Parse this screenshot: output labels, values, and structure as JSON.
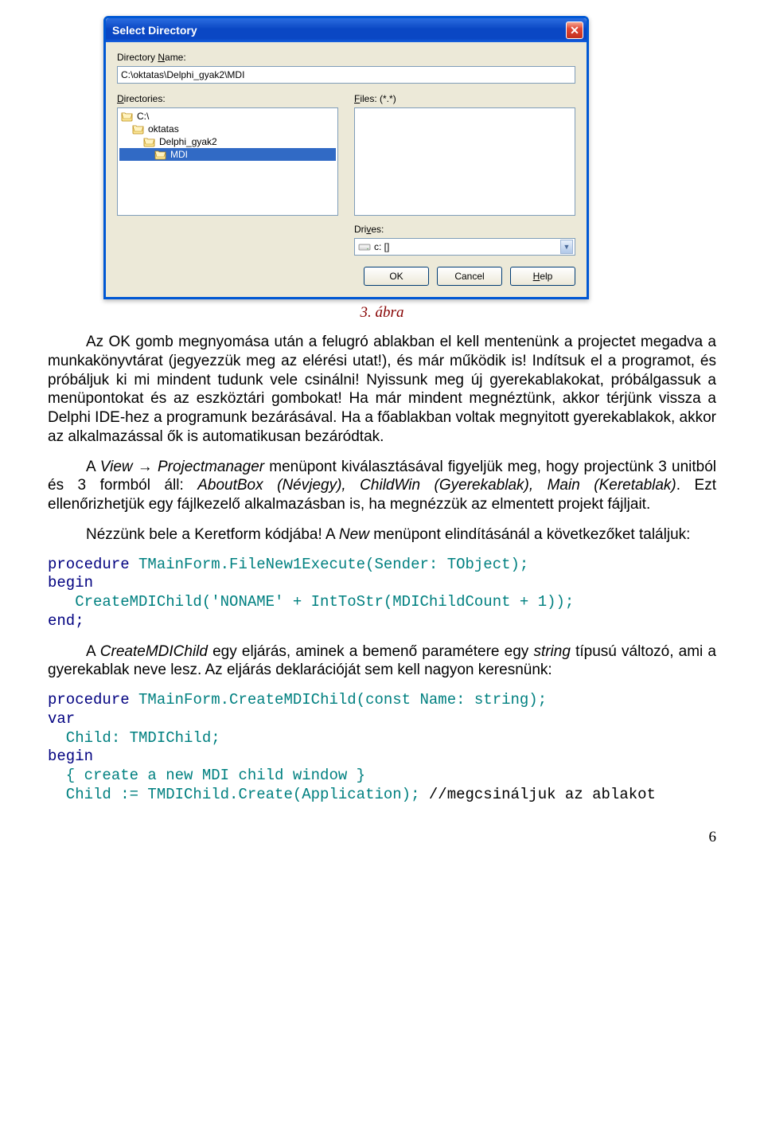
{
  "dialog": {
    "title": "Select Directory",
    "dirname_label": "Directory Name:",
    "dirname_underline": "N",
    "dirname_value": "C:\\oktatas\\Delphi_gyak2\\MDI",
    "directories_label": "Directories:",
    "directories_underline": "D",
    "dir_items": [
      {
        "label": "C:\\",
        "depth": 0,
        "selected": false
      },
      {
        "label": "oktatas",
        "depth": 1,
        "selected": false
      },
      {
        "label": "Delphi_gyak2",
        "depth": 2,
        "selected": false
      },
      {
        "label": "MDI",
        "depth": 3,
        "selected": true
      }
    ],
    "files_label": "Files: (*.*)",
    "files_underline": "F",
    "drives_label": "Drives:",
    "drives_underline": "v",
    "drives_value": "c: []",
    "buttons": {
      "ok": "OK",
      "cancel": "Cancel",
      "help": "Help",
      "help_underline": "H"
    }
  },
  "caption": "3. ábra",
  "paragraphs": {
    "p1": "Az OK gomb megnyomása után a felugró ablakban el kell mentenünk a projectet megadva a munkakönyvtárat (jegyezzük meg az elérési utat!), és már működik is! Indítsuk el a programot, és próbáljuk ki mi mindent tudunk vele csinálni! Nyissunk meg új gyerekablakokat, próbálgassuk a menüpontokat és az eszköztári gombokat! Ha már mindent megnéztünk, akkor térjünk vissza a Delphi IDE-hez a programunk bezárásával. Ha a főablakban voltak megnyitott gyerekablakok, akkor az alkalmazással ők is automatikusan bezáródtak.",
    "p2_a": "A ",
    "p2_b": "View → Projectmanager",
    "p2_c": " menüpont kiválasztásával figyeljük meg, hogy projectünk 3 unitból és 3 formból áll: ",
    "p2_d": "AboutBox (Névjegy), ChildWin (Gyerekablak), Main (Keretablak)",
    "p2_e": ". Ezt ellenőrizhetjük egy fájlkezelő alkalmazásban is, ha megnézzük az elmentett projekt fájljait.",
    "p3_a": "Nézzünk bele a Keretform kódjába! A ",
    "p3_b": "New",
    "p3_c": " menüpont elindításánál a következőket találjuk:",
    "p4_a": "A ",
    "p4_b": "CreateMDIChild",
    "p4_c": " egy eljárás, aminek a bemenő paramétere egy ",
    "p4_d": "string",
    "p4_e": " típusú változó, ami a gyerekablak neve lesz. Az eljárás deklarációját sem kell nagyon keresnünk:"
  },
  "code1": {
    "l1a": "procedure ",
    "l1b": "TMainForm.FileNew1Execute(Sender: TObject);",
    "l2": "begin",
    "l3": "   CreateMDIChild('NONAME' + IntToStr(MDIChildCount + 1));",
    "l4": "end;"
  },
  "code2": {
    "l1a": "procedure ",
    "l1b": "TMainForm.CreateMDIChild(const Name: string);",
    "l2": "var",
    "l3": "  Child: TMDIChild;",
    "l4": "begin",
    "l5a": "  { create a new MDI child window }",
    "l6a": "  Child := TMDIChild.Create(Application);",
    "l6b": " //megcsináljuk az ablakot"
  },
  "page_number": "6"
}
